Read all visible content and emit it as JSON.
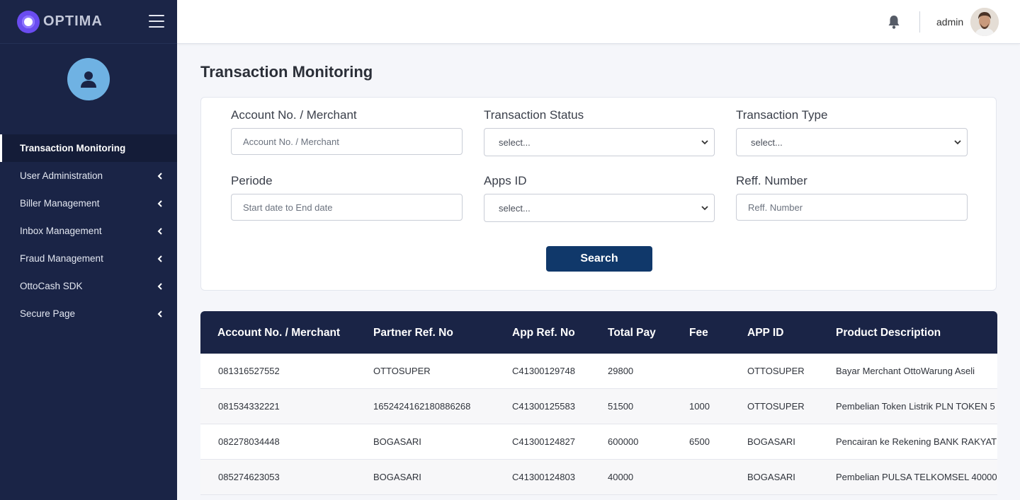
{
  "brand": {
    "name": "OPTIMA"
  },
  "sidebar": {
    "items": [
      {
        "label": "Transaction Monitoring",
        "active": true,
        "has_submenu": false
      },
      {
        "label": "User Administration",
        "active": false,
        "has_submenu": true
      },
      {
        "label": "Biller Management",
        "active": false,
        "has_submenu": true
      },
      {
        "label": "Inbox Management",
        "active": false,
        "has_submenu": true
      },
      {
        "label": "Fraud Management",
        "active": false,
        "has_submenu": true
      },
      {
        "label": "OttoCash SDK",
        "active": false,
        "has_submenu": true
      },
      {
        "label": "Secure Page",
        "active": false,
        "has_submenu": true
      }
    ]
  },
  "header": {
    "username": "admin",
    "icons": [
      "hamburger-icon",
      "bell-icon",
      "user-avatar"
    ]
  },
  "page": {
    "title": "Transaction Monitoring"
  },
  "filters": {
    "account": {
      "label": "Account No. / Merchant",
      "placeholder": "Account No. / Merchant"
    },
    "status": {
      "label": "Transaction Status",
      "value": "select..."
    },
    "type": {
      "label": "Transaction Type",
      "value": "select..."
    },
    "periode": {
      "label": "Periode",
      "placeholder": "Start date to End date"
    },
    "apps_id": {
      "label": "Apps ID",
      "value": "select..."
    },
    "reff": {
      "label": "Reff. Number",
      "placeholder": "Reff. Number"
    },
    "search_label": "Search"
  },
  "table": {
    "columns": [
      "Account No. / Merchant",
      "Partner Ref. No",
      "App Ref. No",
      "Total Pay",
      "Fee",
      "APP ID",
      "Product Description"
    ],
    "rows": [
      [
        "081316527552",
        "OTTOSUPER",
        "C41300129748",
        "29800",
        "",
        "OTTOSUPER",
        "Bayar Merchant OttoWarung Aseli"
      ],
      [
        "081534332221",
        "1652424162180886268",
        "C41300125583",
        "51500",
        "1000",
        "OTTOSUPER",
        "Pembelian Token Listrik PLN TOKEN 5"
      ],
      [
        "082278034448",
        "BOGASARI",
        "C41300124827",
        "600000",
        "6500",
        "BOGASARI",
        "Pencairan ke Rekening BANK RAKYAT"
      ],
      [
        "085274623053",
        "BOGASARI",
        "C41300124803",
        "40000",
        "",
        "BOGASARI",
        "Pembelian PULSA TELKOMSEL 40000"
      ]
    ]
  },
  "colors": {
    "sidebar_bg": "#1a2446",
    "primary_button": "#10386a",
    "avatar_bg": "#6fb2e3",
    "logo": "#6a4cf0"
  }
}
